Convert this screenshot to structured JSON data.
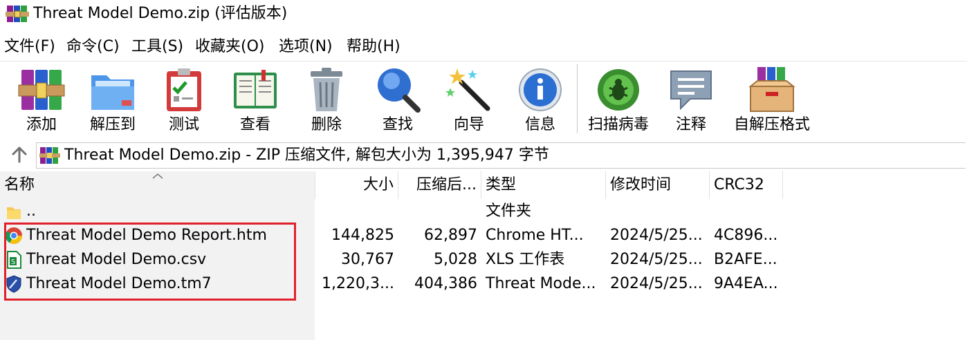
{
  "window": {
    "title": "Threat Model Demo.zip (评估版本)",
    "app_icon": "winrar-books-icon"
  },
  "menu": [
    {
      "label": "文件(F)"
    },
    {
      "label": "命令(C)"
    },
    {
      "label": "工具(S)"
    },
    {
      "label": "收藏夹(O)"
    },
    {
      "label": "选项(N)"
    },
    {
      "label": "帮助(H)"
    }
  ],
  "toolbar": [
    {
      "label": "添加",
      "icon": "add-archive-icon"
    },
    {
      "label": "解压到",
      "icon": "extract-folder-icon"
    },
    {
      "label": "测试",
      "icon": "test-clipboard-icon"
    },
    {
      "label": "查看",
      "icon": "view-book-icon"
    },
    {
      "label": "删除",
      "icon": "trash-icon"
    },
    {
      "label": "查找",
      "icon": "find-magnifier-icon"
    },
    {
      "label": "向导",
      "icon": "wizard-wand-icon"
    },
    {
      "label": "信息",
      "icon": "info-icon"
    },
    {
      "label": "扫描病毒",
      "icon": "virus-scan-icon"
    },
    {
      "label": "注释",
      "icon": "comment-icon"
    },
    {
      "label": "自解压格式",
      "icon": "sfx-box-icon"
    }
  ],
  "address": {
    "text": "Threat Model Demo.zip - ZIP 压缩文件, 解包大小为 1,395,947 字节"
  },
  "columns": {
    "name": "名称",
    "size": "大小",
    "packed": "压缩后...",
    "type": "类型",
    "modified": "修改时间",
    "crc": "CRC32"
  },
  "files": [
    {
      "name": "..",
      "size": "",
      "packed": "",
      "type": "文件夹",
      "modified": "",
      "crc": "",
      "icon": "folder-icon"
    },
    {
      "name": "Threat Model Demo Report.htm",
      "size": "144,825",
      "packed": "62,897",
      "type": "Chrome HT...",
      "modified": "2024/5/25...",
      "crc": "4C896...",
      "icon": "chrome-icon"
    },
    {
      "name": "Threat Model Demo.csv",
      "size": "30,767",
      "packed": "5,028",
      "type": "XLS 工作表",
      "modified": "2024/5/25...",
      "crc": "B2AFE...",
      "icon": "spreadsheet-icon"
    },
    {
      "name": "Threat Model Demo.tm7",
      "size": "1,220,3...",
      "packed": "404,386",
      "type": "Threat Mode...",
      "modified": "2024/5/25...",
      "crc": "9A4EA...",
      "icon": "shield-icon"
    }
  ],
  "colors": {
    "highlight_border": "#e0202a",
    "name_column_bg": "#f2f2f2"
  }
}
